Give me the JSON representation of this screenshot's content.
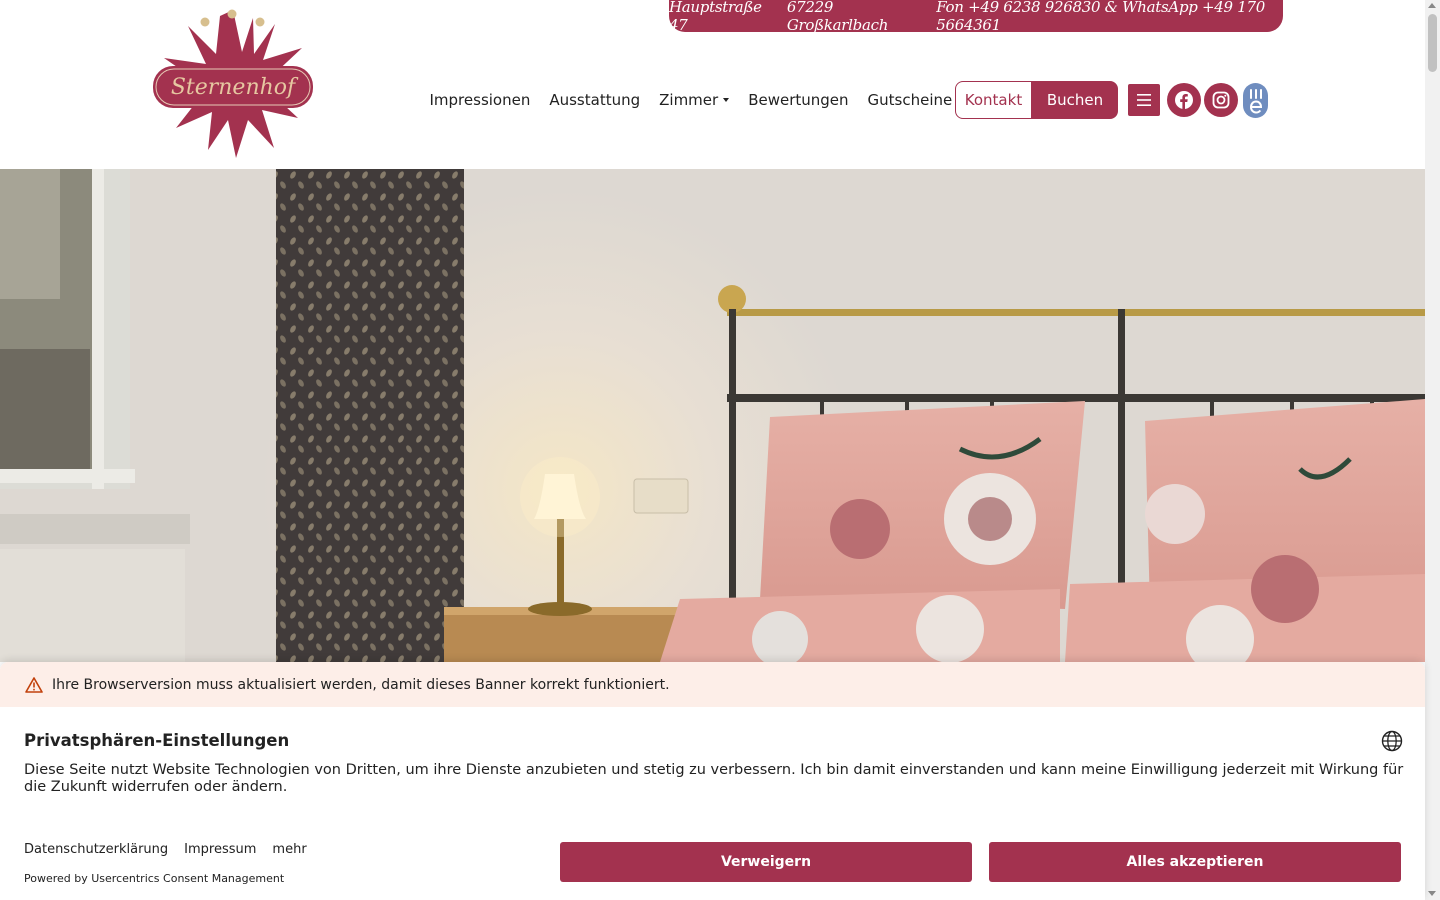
{
  "brand": {
    "logo_text": "Sternenhof",
    "color": "#a3324f"
  },
  "topbar": {
    "street": "Hauptstraße 47",
    "city": "67229 Großkarlbach",
    "phone": "Fon +49 6238 926830 & WhatsApp +49 170 5664361"
  },
  "nav": {
    "items": [
      {
        "label": "Impressionen"
      },
      {
        "label": "Ausstattung"
      },
      {
        "label": "Zimmer"
      },
      {
        "label": "Bewertungen"
      },
      {
        "label": "Gutscheine"
      }
    ],
    "kontakt": "Kontakt",
    "buchen": "Buchen"
  },
  "icons": [
    "menu-icon",
    "facebook-icon",
    "instagram-icon",
    "e-icon"
  ],
  "consent": {
    "warning": "Ihre Browserversion muss aktualisiert werden, damit dieses Banner korrekt funktioniert.",
    "title": "Privatsphären-Einstellungen",
    "text": "Diese Seite nutzt Website Technologien von Dritten, um ihre Dienste anzubieten und stetig zu verbessern. Ich bin damit einverstanden und kann meine Einwilligung jederzeit mit Wirkung für die Zukunft widerrufen oder ändern.",
    "links": [
      "Datenschutzerklärung",
      "Impressum",
      "mehr"
    ],
    "powered": "Powered by Usercentrics Consent Management",
    "deny": "Verweigern",
    "accept": "Alles akzeptieren"
  }
}
